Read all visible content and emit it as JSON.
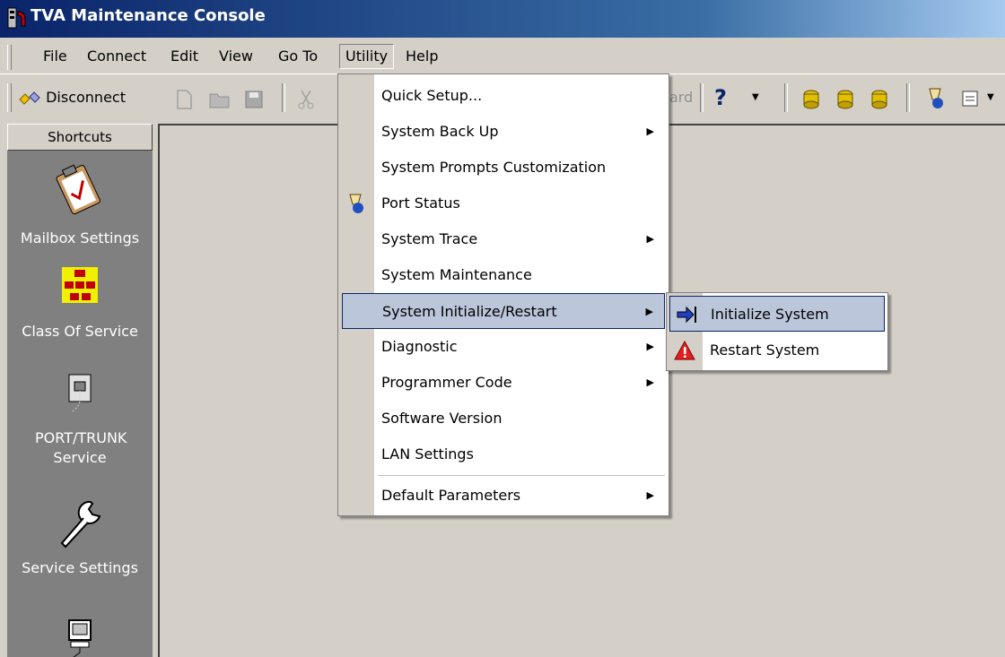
{
  "window": {
    "title": "TVA Maintenance Console"
  },
  "menubar": {
    "file": "File",
    "connect": "Connect",
    "edit": "Edit",
    "view": "View",
    "goto": "Go To",
    "utility": "Utility",
    "help": "Help"
  },
  "toolbar": {
    "disconnect": "Disconnect",
    "wizard_fragment": "ard",
    "help_glyph": "?"
  },
  "sidebar": {
    "header": "Shortcuts",
    "items": [
      {
        "label": "Mailbox Settings"
      },
      {
        "label": "Class Of Service"
      },
      {
        "label": "PORT/TRUNK Service"
      },
      {
        "label": "Service Settings"
      }
    ]
  },
  "utility_menu": {
    "items": [
      {
        "label": "Quick Setup...",
        "submenu": false
      },
      {
        "label": "System Back Up",
        "submenu": true
      },
      {
        "label": "System Prompts Customization",
        "submenu": false
      },
      {
        "label": "Port Status",
        "submenu": false
      },
      {
        "label": "System Trace",
        "submenu": true
      },
      {
        "label": "System Maintenance",
        "submenu": false
      },
      {
        "label": "System Initialize/Restart",
        "submenu": true,
        "highlighted": true
      },
      {
        "label": "Diagnostic",
        "submenu": true
      },
      {
        "label": "Programmer Code",
        "submenu": true
      },
      {
        "label": "Software Version",
        "submenu": false
      },
      {
        "label": "LAN Settings",
        "submenu": false
      },
      {
        "label": "Default Parameters",
        "submenu": true
      }
    ]
  },
  "submenu": {
    "items": [
      {
        "label": "Initialize System",
        "highlighted": true
      },
      {
        "label": "Restart System"
      }
    ]
  },
  "colors": {
    "titlebar": "#0a246a",
    "highlight": "#bcc6da",
    "face": "#d4d0c8"
  }
}
